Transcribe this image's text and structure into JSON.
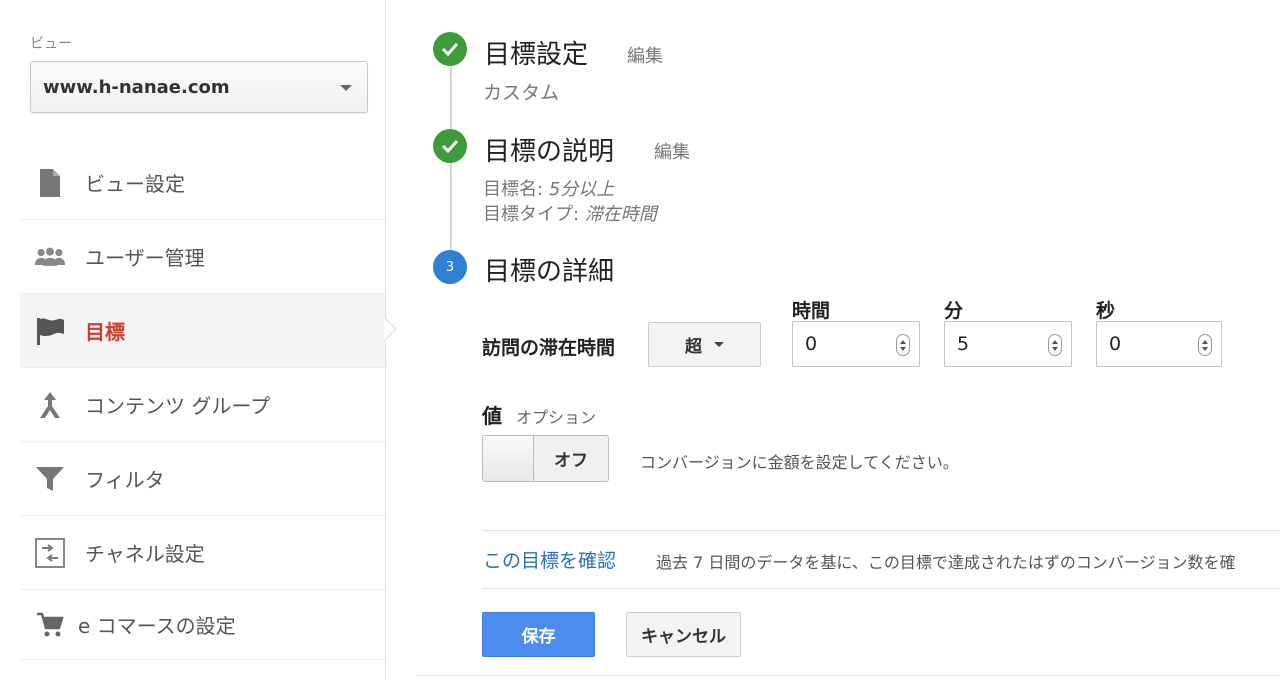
{
  "sidebar": {
    "view_label": "ビュー",
    "view_select": "www.h-nanae.com",
    "items": [
      {
        "label": "ビュー設定",
        "icon": "document-icon"
      },
      {
        "label": "ユーザー管理",
        "icon": "users-icon"
      },
      {
        "label": "目標",
        "icon": "flag-icon",
        "active": true
      },
      {
        "label": "コンテンツ グループ",
        "icon": "content-group-icon"
      },
      {
        "label": "フィルタ",
        "icon": "filter-icon"
      },
      {
        "label": "チャネル設定",
        "icon": "channel-icon"
      },
      {
        "label": "e コマースの設定",
        "icon": "cart-icon"
      }
    ]
  },
  "steps": {
    "goal_setting": {
      "title": "目標設定",
      "edit": "編集",
      "value": "カスタム"
    },
    "goal_description": {
      "title": "目標の説明",
      "edit": "編集",
      "name_label": "目標名:",
      "name_value": "5分以上",
      "type_label": "目標タイプ:",
      "type_value": "滞在時間"
    },
    "goal_details": {
      "number": "3",
      "title": "目標の詳細"
    }
  },
  "details": {
    "duration_label": "訪問の滞在時間",
    "comparator": "超",
    "hours_label": "時間",
    "hours": "0",
    "minutes_label": "分",
    "minutes": "5",
    "seconds_label": "秒",
    "seconds": "0",
    "value_label": "値",
    "value_optional": "オプション",
    "toggle_state": "オフ",
    "conversion_help": "コンバージョンに金額を設定してください。"
  },
  "verify": {
    "link": "この目標を確認",
    "description": "過去 7 日間のデータを基に、この目標で達成されたはずのコンバージョン数を確"
  },
  "actions": {
    "save": "保存",
    "cancel": "キャンセル"
  },
  "colors": {
    "active_nav": "#d03b2e",
    "done_step": "#3d9c39",
    "current_step": "#2f7fd2",
    "save_button": "#4a8cf0",
    "link": "#2a6fbf"
  }
}
